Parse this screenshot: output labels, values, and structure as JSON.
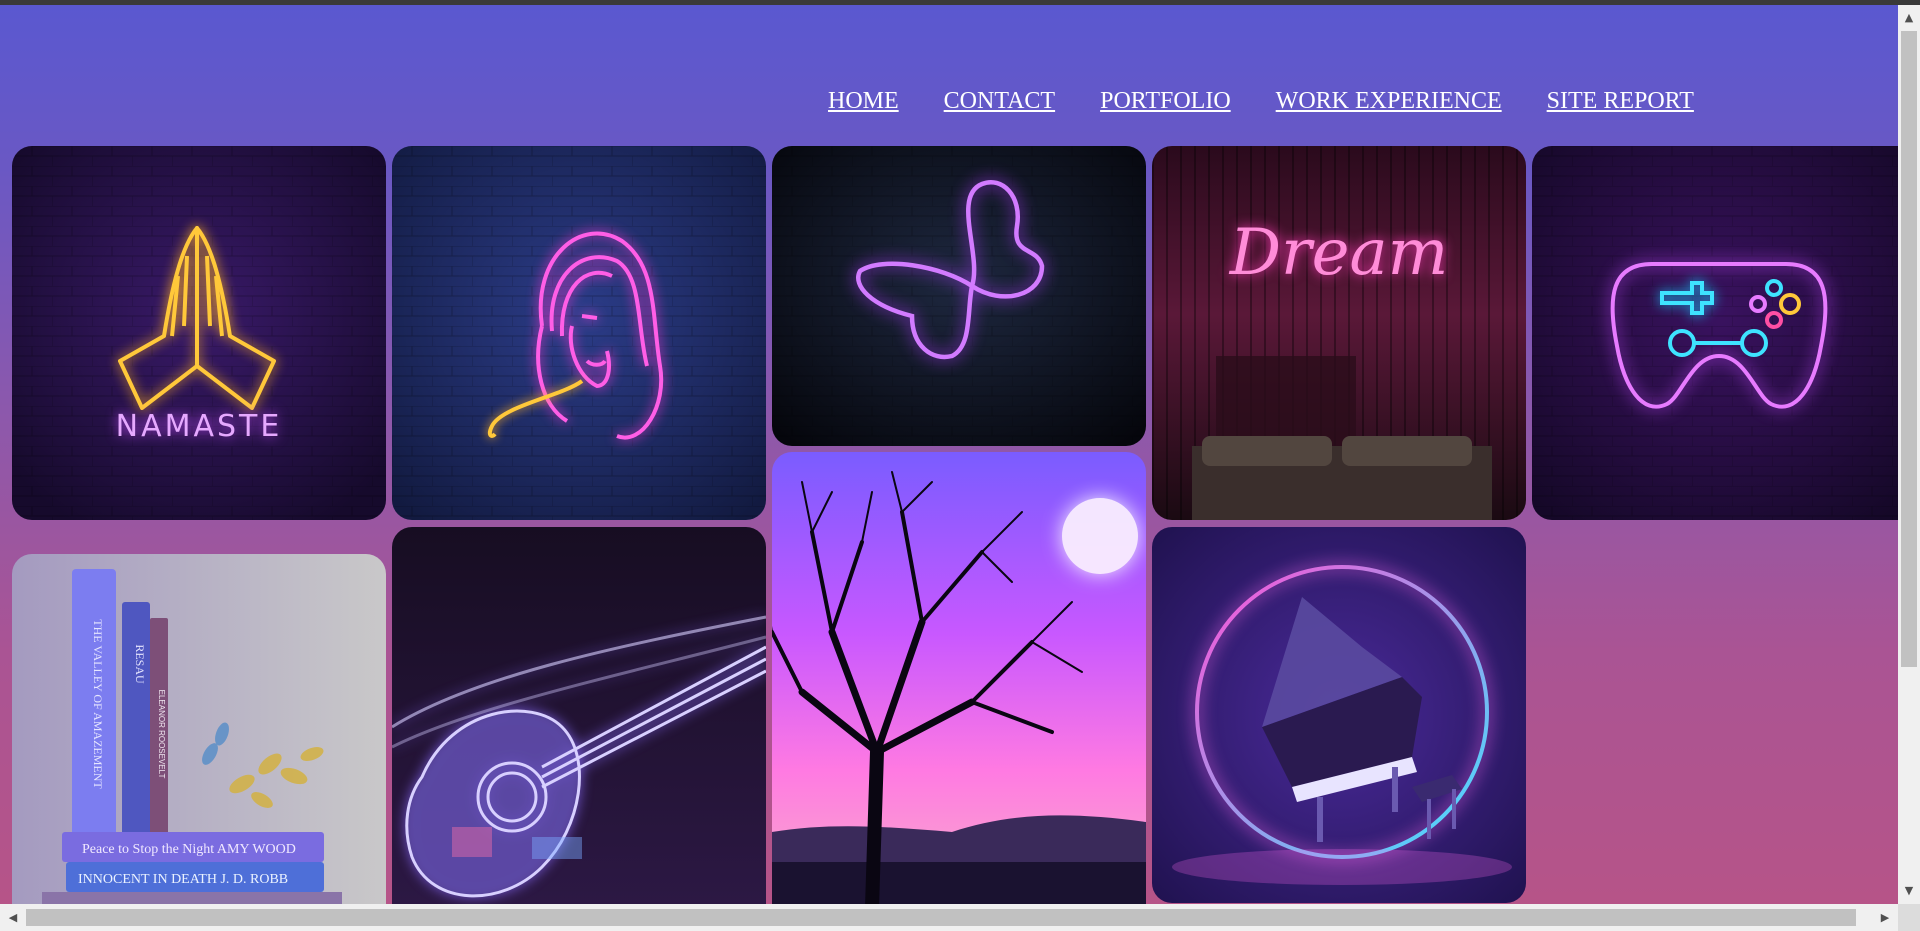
{
  "nav": {
    "items": [
      {
        "label": "HOME"
      },
      {
        "label": "CONTACT"
      },
      {
        "label": "PORTFOLIO"
      },
      {
        "label": "WORK EXPERIENCE"
      },
      {
        "label": "SITE REPORT"
      }
    ]
  },
  "gallery": {
    "namaste": {
      "text": "NAMASTE"
    },
    "dream": {
      "text": "Dream"
    },
    "books": {
      "spine_1": "THE VALLEY OF AMAZEMENT",
      "spine_2": "RESAU",
      "spine_3": "ELEANOR ROOSEVELT",
      "book_4": "Peace to Stop the Night   AMY WOOD",
      "book_5": "INNOCENT IN DEATH   J. D. ROBB"
    }
  },
  "colors": {
    "bg_top": "#5a58d0",
    "bg_bottom": "#b65488",
    "nav_text": "#ffffff",
    "neon_pink": "#ff5ee6",
    "neon_purple": "#c64bff",
    "neon_gold": "#ffc83a",
    "neon_cyan": "#3ee3ff"
  },
  "icons": [
    "praying-hands-icon",
    "woman-face-icon",
    "butterfly-icon",
    "gamepad-icon",
    "piano-icon",
    "guitar-icon",
    "tree-icon",
    "moon-icon"
  ]
}
